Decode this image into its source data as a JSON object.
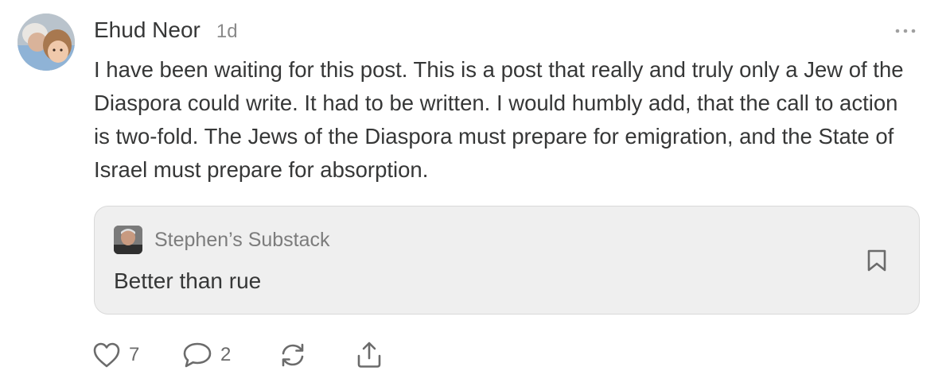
{
  "comment": {
    "author": "Ehud Neor",
    "timestamp": "1d",
    "body": "I have been waiting for this post. This is a post that really and truly only a Jew of the Diaspora could write. It had to be written. I would humbly add, that the call to action is two-fold. The Jews of the Diaspora must prepare for emigration, and the State of Israel must prepare for absorption."
  },
  "embed": {
    "publication": "Stephen’s Substack",
    "post_title": "Better than rue"
  },
  "actions": {
    "likes": "7",
    "replies": "2"
  },
  "icons": {
    "more": "more-horizontal-icon",
    "bookmark": "bookmark-icon",
    "like": "heart-icon",
    "reply": "comment-bubble-icon",
    "restack": "restack-icon",
    "share": "share-icon"
  },
  "colors": {
    "text": "#363737",
    "muted": "#8a8a8a",
    "icon": "#6b6b6b",
    "embed_bg": "#efefef",
    "embed_border": "#d9d9d9"
  }
}
